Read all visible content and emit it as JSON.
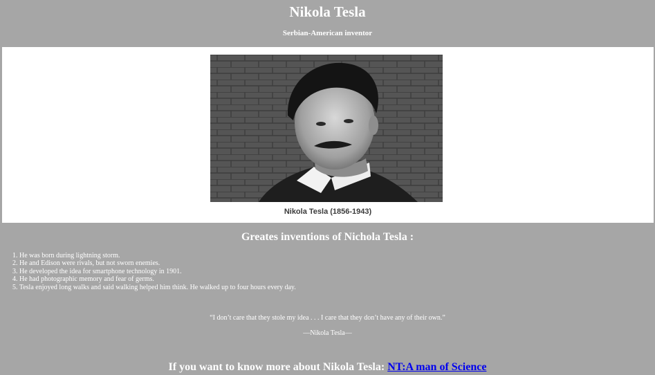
{
  "header": {
    "title": "Nikola Tesla",
    "subtitle": "Serbian-American inventor"
  },
  "figure": {
    "image_description_icon": "portrait-photo-icon",
    "caption": "Nikola Tesla (1856-1943)"
  },
  "inventions": {
    "heading": "Greates inventions of Nichola Tesla :",
    "items": [
      "1. He was born during lightning storm.",
      "2. He and Edison were rivals, but not sworn enemies.",
      "3. He developed the idea for smartphone technology in 1901.",
      "4. He had photographic memory and fear of germs.",
      "5. Tesla enjoyed long walks and said walking helped him think. He walked up to four hours every day."
    ]
  },
  "quote": {
    "text": "“I don’t care that they stole my idea . . . I care that they don’t have any of their own.”",
    "author": "—Nikola Tesla—"
  },
  "footer": {
    "prompt": "If you want to know more about Nikola Tesla: ",
    "link_text": "NT:A man of Science"
  },
  "colors": {
    "page_background": "#a6a6a6",
    "panel_background": "#ffffff",
    "text": "#ffffff",
    "link": "#0000ee"
  }
}
